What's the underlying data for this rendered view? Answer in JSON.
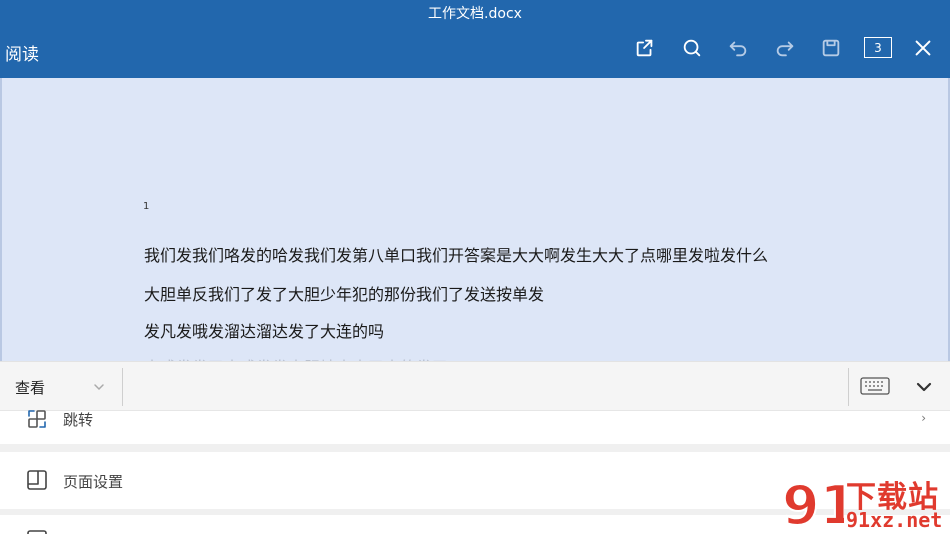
{
  "window": {
    "title": "工作文档.docx"
  },
  "header": {
    "mode_label": "阅读",
    "page_count": "3"
  },
  "document": {
    "marker": "1",
    "paragraphs": [
      "我们发我们咯发的哈发我们发第八单口我们开答案是大大啊发生大大了点哪里发啦发什么",
      "大胆单反我们了发了大胆少年犯的那份我们了发送按单发",
      "发凡发哦发溜达溜达发了大连的吗",
      "大成发发了大成发发大胆地大大了大的发了"
    ]
  },
  "toolbar": {
    "view_label": "查看"
  },
  "menu": {
    "items": [
      {
        "label": "跳转"
      },
      {
        "label": "页面设置"
      }
    ]
  },
  "watermark": {
    "top_text": "下载站",
    "bottom_text": "91xz.net",
    "logo_text": "91"
  },
  "colors": {
    "header_bg": "#2267ad",
    "doc_bg": "#dde6f7",
    "watermark": "#e03a2e"
  }
}
